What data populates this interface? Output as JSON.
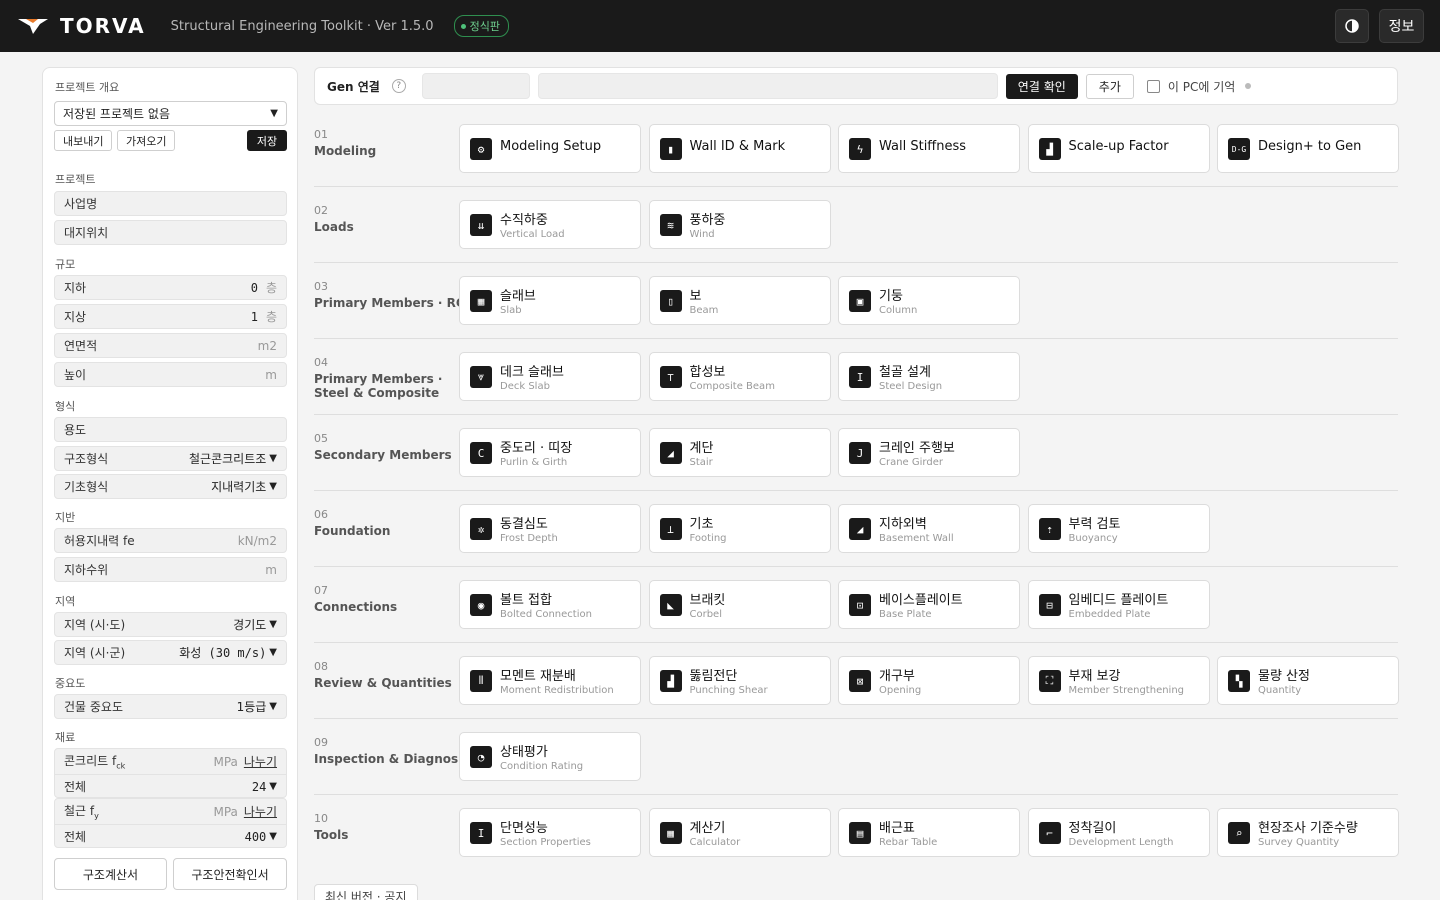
{
  "header": {
    "brand": "TORVA",
    "subtitle": "Structural Engineering Toolkit · Ver 1.5.0",
    "edition": "정식판",
    "info_label": "정보"
  },
  "sidebar": {
    "overview_label": "프로젝트 개요",
    "project_select": "저장된 프로젝트 없음",
    "export_label": "내보내기",
    "import_label": "가져오기",
    "save_label": "저장",
    "project_label": "프로젝트",
    "project_name_placeholder": "사업명",
    "site_placeholder": "대지위치",
    "scale_label": "규모",
    "basement_label": "지하",
    "basement_value": "0",
    "basement_unit": "층",
    "above_label": "지상",
    "above_value": "1",
    "above_unit": "층",
    "area_label": "연면적",
    "area_unit": "m2",
    "height_label": "높이",
    "height_unit": "m",
    "type_label": "형식",
    "usage_placeholder": "용도",
    "structure_label": "구조형식",
    "structure_value": "철근콘크리트조",
    "foundation_label": "기초형식",
    "foundation_value": "지내력기초",
    "ground_label": "지반",
    "bearing_label": "허용지내력 fe",
    "bearing_unit": "kN/m2",
    "water_label": "지하수위",
    "water_unit": "m",
    "region_label": "지역",
    "region1_label": "지역 (시·도)",
    "region1_value": "경기도",
    "region2_label": "지역 (시·군)",
    "region2_value": "화성 (30 m/s)",
    "importance_label": "중요도",
    "importance_field": "건물 중요도",
    "importance_value": "1등급",
    "material_label": "재료",
    "concrete_label": "콘크리트 f",
    "concrete_sub": "ck",
    "concrete_unit": "MPa",
    "concrete_split": "나누기",
    "concrete_all": "전체",
    "concrete_value": "24",
    "rebar_label": "철근 f",
    "rebar_sub": "y",
    "rebar_unit": "MPa",
    "rebar_split": "나누기",
    "rebar_all": "전체",
    "rebar_value": "400",
    "report1": "구조계산서",
    "report2": "구조안전확인서"
  },
  "genbar": {
    "label": "Gen 연결",
    "help": "?",
    "connect": "연결 확인",
    "add": "추가",
    "remember": "이 PC에 기억"
  },
  "categories": [
    {
      "num": "01",
      "name": "Modeling",
      "cards": [
        {
          "icon": "gear-icon",
          "glyph": "⚙",
          "title": "Modeling Setup"
        },
        {
          "icon": "wall-id-icon",
          "glyph": "▮",
          "title": "Wall ID & Mark"
        },
        {
          "icon": "wall-stiffness-icon",
          "glyph": "ϟ",
          "title": "Wall Stiffness"
        },
        {
          "icon": "bar-chart-icon",
          "glyph": "▟",
          "title": "Scale-up Factor"
        },
        {
          "icon": "dg-icon",
          "glyph": "D-G",
          "title": "Design+ to Gen"
        }
      ]
    },
    {
      "num": "02",
      "name": "Loads",
      "cards": [
        {
          "icon": "vertical-load-icon",
          "glyph": "⇊",
          "title": "수직하중",
          "sub": "Vertical Load"
        },
        {
          "icon": "wind-icon",
          "glyph": "≋",
          "title": "풍하중",
          "sub": "Wind"
        }
      ]
    },
    {
      "num": "03",
      "name": "Primary Members · RC",
      "cards": [
        {
          "icon": "slab-icon",
          "glyph": "▦",
          "title": "슬래브",
          "sub": "Slab"
        },
        {
          "icon": "beam-icon",
          "glyph": "▯",
          "title": "보",
          "sub": "Beam"
        },
        {
          "icon": "column-icon",
          "glyph": "▣",
          "title": "기둥",
          "sub": "Column"
        }
      ]
    },
    {
      "num": "04",
      "name": "Primary Members ·",
      "name2": "Steel & Composite",
      "cards": [
        {
          "icon": "deck-slab-icon",
          "glyph": "⩔",
          "title": "데크 슬래브",
          "sub": "Deck Slab"
        },
        {
          "icon": "composite-beam-icon",
          "glyph": "⊤",
          "title": "합성보",
          "sub": "Composite Beam"
        },
        {
          "icon": "steel-design-icon",
          "glyph": "I",
          "title": "철골 설계",
          "sub": "Steel Design"
        }
      ]
    },
    {
      "num": "05",
      "name": "Secondary Members",
      "cards": [
        {
          "icon": "purlin-icon",
          "glyph": "C",
          "title": "중도리 · 띠장",
          "sub": "Purlin & Girth"
        },
        {
          "icon": "stair-icon",
          "glyph": "◢",
          "title": "계단",
          "sub": "Stair"
        },
        {
          "icon": "crane-icon",
          "glyph": "J",
          "title": "크레인 주행보",
          "sub": "Crane Girder"
        }
      ]
    },
    {
      "num": "06",
      "name": "Foundation",
      "cards": [
        {
          "icon": "frost-depth-icon",
          "glyph": "✲",
          "title": "동결심도",
          "sub": "Frost Depth"
        },
        {
          "icon": "footing-icon",
          "glyph": "⊥",
          "title": "기초",
          "sub": "Footing"
        },
        {
          "icon": "basement-wall-icon",
          "glyph": "◢",
          "title": "지하외벽",
          "sub": "Basement Wall"
        },
        {
          "icon": "buoyancy-icon",
          "glyph": "⇡",
          "title": "부력 검토",
          "sub": "Buoyancy"
        }
      ]
    },
    {
      "num": "07",
      "name": "Connections",
      "cards": [
        {
          "icon": "bolt-icon",
          "glyph": "◉",
          "title": "볼트 접합",
          "sub": "Bolted Connection"
        },
        {
          "icon": "corbel-icon",
          "glyph": "◣",
          "title": "브래킷",
          "sub": "Corbel"
        },
        {
          "icon": "base-plate-icon",
          "glyph": "⊡",
          "title": "베이스플레이트",
          "sub": "Base Plate"
        },
        {
          "icon": "embedded-plate-icon",
          "glyph": "⊟",
          "title": "임베디드 플레이트",
          "sub": "Embedded Plate"
        }
      ]
    },
    {
      "num": "08",
      "name": "Review & Quantities",
      "cards": [
        {
          "icon": "moment-icon",
          "glyph": "⫴",
          "title": "모멘트 재분배",
          "sub": "Moment Redistribution"
        },
        {
          "icon": "punching-icon",
          "glyph": "▟",
          "title": "뚫림전단",
          "sub": "Punching Shear"
        },
        {
          "icon": "opening-icon",
          "glyph": "⊠",
          "title": "개구부",
          "sub": "Opening"
        },
        {
          "icon": "strengthening-icon",
          "glyph": "⛶",
          "title": "부재 보강",
          "sub": "Member Strengthening"
        },
        {
          "icon": "quantity-icon",
          "glyph": "▚",
          "title": "물량 산정",
          "sub": "Quantity"
        }
      ]
    },
    {
      "num": "09",
      "name": "Inspection & Diagnosis",
      "cards": [
        {
          "icon": "gauge-icon",
          "glyph": "◔",
          "title": "상태평가",
          "sub": "Condition Rating"
        }
      ]
    },
    {
      "num": "10",
      "name": "Tools",
      "cards": [
        {
          "icon": "section-icon",
          "glyph": "I",
          "title": "단면성능",
          "sub": "Section Properties"
        },
        {
          "icon": "calculator-icon",
          "glyph": "▦",
          "title": "계산기",
          "sub": "Calculator"
        },
        {
          "icon": "rebar-table-icon",
          "glyph": "▤",
          "title": "배근표",
          "sub": "Rebar Table"
        },
        {
          "icon": "dev-length-icon",
          "glyph": "⌐",
          "title": "정착길이",
          "sub": "Development Length"
        },
        {
          "icon": "survey-icon",
          "glyph": "⌕",
          "title": "현장조사 기준수량",
          "sub": "Survey Quantity"
        }
      ]
    }
  ],
  "notice": "최신 버전 · 공지"
}
